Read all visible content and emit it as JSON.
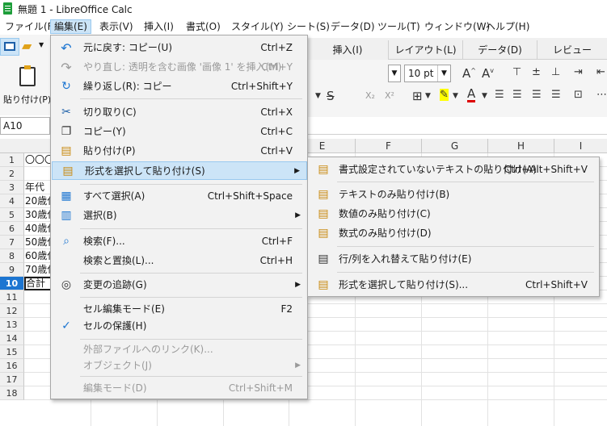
{
  "window": {
    "title": "無題 1 - LibreOffice Calc"
  },
  "menubar": [
    "ファイル(F)",
    "編集(E)",
    "表示(V)",
    "挿入(I)",
    "書式(O)",
    "スタイル(Y)",
    "シート(S)",
    "データ(D)",
    "ツール(T)",
    "ウィンドウ(W)",
    "ヘルプ(H)"
  ],
  "tabs": [
    "挿入(I)",
    "レイアウト(L)",
    "データ(D)",
    "レビュー"
  ],
  "toolbar": {
    "paste_label": "貼り付け(P)",
    "font_size": "10 pt"
  },
  "namebox": "A10",
  "columns": [
    "D",
    "E",
    "F",
    "G",
    "H",
    "I"
  ],
  "rows": [
    "1",
    "2",
    "3",
    "4",
    "5",
    "6",
    "7",
    "8",
    "9",
    "10",
    "11",
    "12",
    "13",
    "14",
    "15",
    "16",
    "17",
    "18"
  ],
  "cells": [
    "〇〇〇",
    "",
    "年代",
    "20歳代",
    "30歳代",
    "40歳代",
    "50歳代",
    "60歳代",
    "70歳代",
    "合計"
  ],
  "edit_menu": [
    {
      "label": "元に戻す: コピー(U)",
      "shortcut": "Ctrl+Z",
      "icon": "undo-icon"
    },
    {
      "label": "やり直し: 透明を含む画像 '画像 1' を挿入(M)",
      "shortcut": "Ctrl+Y",
      "icon": "redo-icon",
      "disabled": true
    },
    {
      "label": "繰り返し(R): コピー",
      "shortcut": "Ctrl+Shift+Y",
      "icon": "repeat-icon"
    },
    {
      "label": "切り取り(C)",
      "shortcut": "Ctrl+X",
      "icon": "cut-icon"
    },
    {
      "label": "コピー(Y)",
      "shortcut": "Ctrl+C",
      "icon": "copy-icon"
    },
    {
      "label": "貼り付け(P)",
      "shortcut": "Ctrl+V",
      "icon": "paste-icon"
    },
    {
      "label": "形式を選択して貼り付け(S)",
      "shortcut": "",
      "icon": "paste-special-icon",
      "submenu": true,
      "highlighted": true
    },
    {
      "label": "すべて選択(A)",
      "shortcut": "Ctrl+Shift+Space",
      "icon": "select-all-icon"
    },
    {
      "label": "選択(B)",
      "shortcut": "",
      "icon": "select-icon",
      "submenu": true
    },
    {
      "label": "検索(F)...",
      "shortcut": "Ctrl+F",
      "icon": "find-icon"
    },
    {
      "label": "検索と置換(L)...",
      "shortcut": "Ctrl+H",
      "icon": ""
    },
    {
      "label": "変更の追跡(G)",
      "shortcut": "",
      "icon": "track-changes-icon",
      "submenu": true
    },
    {
      "label": "セル編集モード(E)",
      "shortcut": "F2",
      "icon": ""
    },
    {
      "label": "セルの保護(H)",
      "shortcut": "",
      "icon": "checkmark-icon"
    },
    {
      "label": "外部ファイルへのリンク(K)...",
      "shortcut": "",
      "icon": "",
      "disabled": true
    },
    {
      "label": "オブジェクト(J)",
      "shortcut": "",
      "icon": "",
      "submenu": true,
      "disabled": true
    },
    {
      "label": "編集モード(D)",
      "shortcut": "Ctrl+Shift+M",
      "icon": "",
      "disabled": true
    }
  ],
  "paste_special_menu": [
    {
      "label": "書式設定されていないテキストの貼り付け(A)",
      "shortcut": "Ctrl+Alt+Shift+V",
      "icon": "paste-unformatted-icon"
    },
    {
      "label": "テキストのみ貼り付け(B)",
      "shortcut": "",
      "icon": "paste-text-only-icon"
    },
    {
      "label": "数値のみ貼り付け(C)",
      "shortcut": "",
      "icon": "paste-numbers-only-icon"
    },
    {
      "label": "数式のみ貼り付け(D)",
      "shortcut": "",
      "icon": "paste-formulas-only-icon"
    },
    {
      "label": "行/列を入れ替えて貼り付け(E)",
      "shortcut": "",
      "icon": "paste-transposed-icon"
    },
    {
      "label": "形式を選択して貼り付け(S)...",
      "shortcut": "Ctrl+Shift+V",
      "icon": "paste-special-icon"
    }
  ]
}
